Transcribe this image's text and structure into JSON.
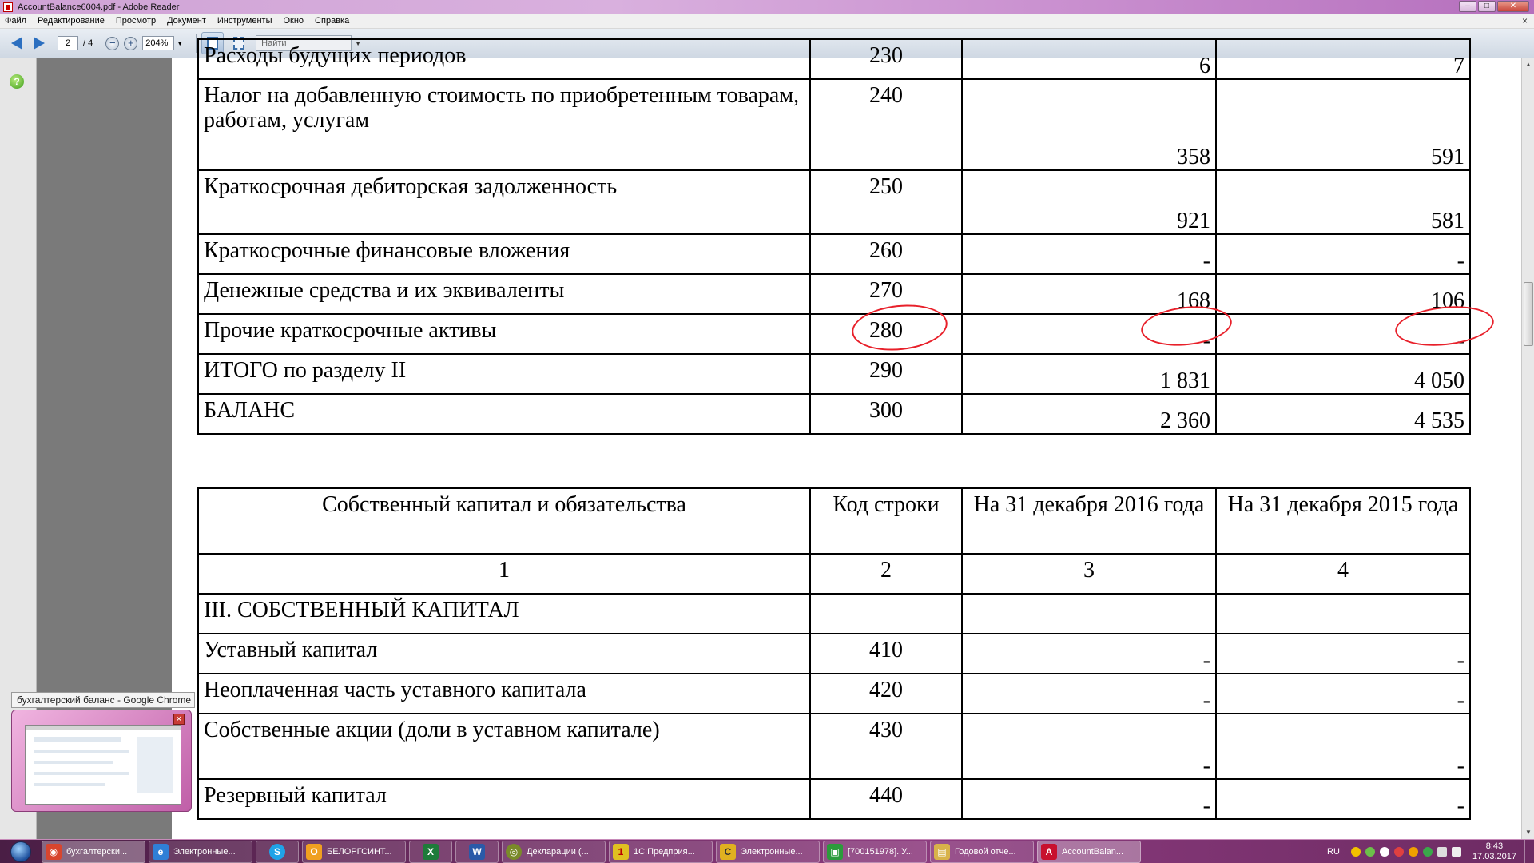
{
  "window": {
    "title": "AccountBalance6004.pdf - Adobe Reader",
    "min": "–",
    "max": "□",
    "close": "✕"
  },
  "menu": [
    "Файл",
    "Редактирование",
    "Просмотр",
    "Документ",
    "Инструменты",
    "Окно",
    "Справка"
  ],
  "menu_close": "×",
  "toolbar": {
    "page_current": "2",
    "page_total": "/ 4",
    "zoom": "204%",
    "search_placeholder": "Найти",
    "zoom_out": "−",
    "zoom_in": "+"
  },
  "leftnav": {
    "help": "?"
  },
  "table_top": {
    "rows": [
      {
        "name": "Расходы будущих периодов",
        "code": "230",
        "v2016": "6",
        "v2015": "7"
      },
      {
        "name": "Налог на добавленную стоимость по приобретенным товарам, работам, услугам",
        "code": "240",
        "v2016": "358",
        "v2015": "591"
      },
      {
        "name": "Краткосрочная дебиторская задолженность",
        "code": "250",
        "v2016": "921",
        "v2015": "581"
      },
      {
        "name": "Краткосрочные финансовые вложения",
        "code": "260",
        "v2016": "-",
        "v2015": "-"
      },
      {
        "name": "Денежные средства и их эквиваленты",
        "code": "270",
        "v2016": "168",
        "v2015": "106"
      },
      {
        "name": "Прочие краткосрочные активы",
        "code": "280",
        "v2016": "-",
        "v2015": "-"
      },
      {
        "name": "ИТОГО по разделу II",
        "code": "290",
        "v2016": "1 831",
        "v2015": "4 050"
      },
      {
        "name": "БАЛАНС",
        "code": "300",
        "v2016": "2 360",
        "v2015": "4 535"
      }
    ]
  },
  "table_bottom": {
    "header": {
      "name": "Собственный капитал и обязательства",
      "code": "Код строки",
      "v2016": "На 31 декабря 2016 года",
      "v2015": "На 31 декабря 2015 года"
    },
    "numbers": [
      "1",
      "2",
      "3",
      "4"
    ],
    "section": "III. СОБСТВЕННЫЙ КАПИТАЛ",
    "rows": [
      {
        "name": "Уставный капитал",
        "code": "410",
        "v2016": "-",
        "v2015": "-"
      },
      {
        "name": "Неоплаченная часть уставного капитала",
        "code": "420",
        "v2016": "-",
        "v2015": "-"
      },
      {
        "name": "Собственные акции (доли в уставном капитале)",
        "code": "430",
        "v2016": "-",
        "v2015": "-"
      },
      {
        "name": "Резервный капитал",
        "code": "440",
        "v2016": "-",
        "v2015": "-"
      }
    ]
  },
  "popup": {
    "label": "бухгалтерский баланс - Google Chrome",
    "close": "✕"
  },
  "taskbar": {
    "tasks": [
      {
        "label": "бухгалтерски...",
        "color": "#d8452e",
        "glyph": "◉",
        "active": true
      },
      {
        "label": "Электронные...",
        "color": "#2f7fd6",
        "glyph": "e"
      },
      {
        "label": "",
        "color": "#1fa3e8",
        "glyph": "S"
      },
      {
        "label": "БЕЛОРГСИНТ...",
        "color": "#f0a020",
        "glyph": "O"
      },
      {
        "label": "",
        "color": "#1e7b3a",
        "glyph": "X"
      },
      {
        "label": "",
        "color": "#2a5aa8",
        "glyph": "W"
      },
      {
        "label": "Декларации (...",
        "color": "#7a8a2a",
        "glyph": "◎"
      },
      {
        "label": "1С:Предприя...",
        "color": "#e0c020",
        "glyph": "1"
      },
      {
        "label": "Электронные...",
        "color": "#e0b020",
        "glyph": "C"
      },
      {
        "label": "[700151978]. У...",
        "color": "#2c9b3c",
        "glyph": "▣"
      },
      {
        "label": "Годовой отче...",
        "color": "#d8b24a",
        "glyph": "▤"
      },
      {
        "label": "AccountBalan...",
        "color": "#c8102e",
        "glyph": "A"
      }
    ],
    "lang": "RU",
    "time": "8:43",
    "date": "17.03.2017"
  }
}
